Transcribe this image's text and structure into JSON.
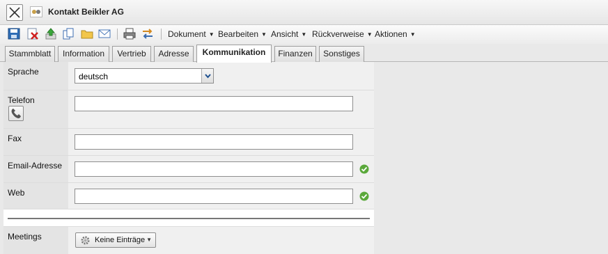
{
  "window": {
    "title": "Kontakt Beikler AG"
  },
  "toolbar": {
    "icons": [
      "save-icon",
      "delete-icon",
      "upload-icon",
      "copy-icon",
      "folder-icon",
      "email-icon",
      "print-icon",
      "swap-icon"
    ],
    "menus": [
      {
        "label": "Dokument"
      },
      {
        "label": "Bearbeiten"
      },
      {
        "label": "Ansicht"
      },
      {
        "label": "Rückverweise"
      },
      {
        "label": "Aktionen"
      }
    ]
  },
  "tabs": [
    {
      "label": "Stammblatt",
      "active": false
    },
    {
      "label": "Information",
      "active": false
    },
    {
      "label": "Vertrieb",
      "active": false
    },
    {
      "label": "Adresse",
      "active": false
    },
    {
      "label": "Kommunikation",
      "active": true
    },
    {
      "label": "Finanzen",
      "active": false
    },
    {
      "label": "Sonstiges",
      "active": false
    }
  ],
  "form": {
    "sprache": {
      "label": "Sprache",
      "value": "deutsch"
    },
    "telefon": {
      "label": "Telefon",
      "value": ""
    },
    "fax": {
      "label": "Fax",
      "value": ""
    },
    "email": {
      "label": "Email-Adresse",
      "value": ""
    },
    "web": {
      "label": "Web",
      "value": ""
    },
    "meetings": {
      "label": "Meetings",
      "button_label": "Keine Einträge"
    }
  },
  "colors": {
    "valid_check": "#5aa83a",
    "label_bg": "#e4e4e4",
    "field_bg": "#f0f0f0"
  }
}
